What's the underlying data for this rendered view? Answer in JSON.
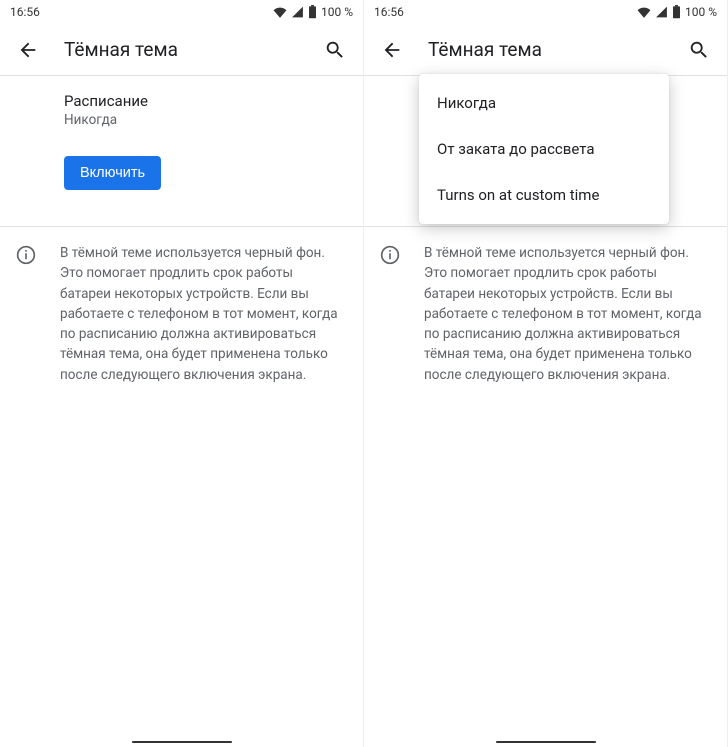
{
  "status": {
    "time": "16:56",
    "battery": "100 %"
  },
  "appbar": {
    "title": "Тёмная тема"
  },
  "schedule": {
    "label": "Расписание",
    "value": "Никогда"
  },
  "button": {
    "enable": "Включить"
  },
  "info": {
    "text": "В тёмной теме используется черный фон. Это помогает продлить срок работы батареи некоторых устройств. Если вы работаете с телефоном в тот момент, когда по расписанию должна активироваться тёмная тема, она будет применена только после следующего включения экрана."
  },
  "dropdown": {
    "items": [
      "Никогда",
      "От заката до рассвета",
      "Turns on at custom time"
    ]
  }
}
